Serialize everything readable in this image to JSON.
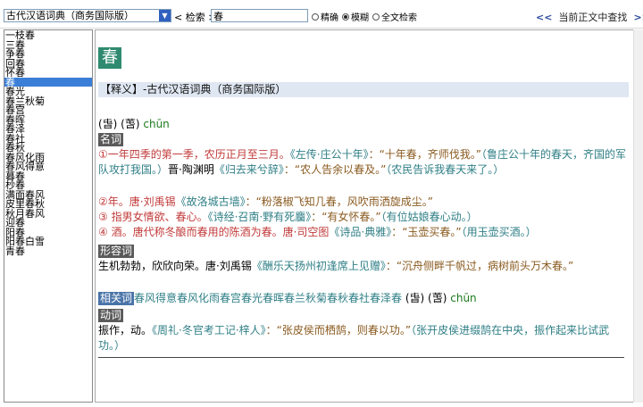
{
  "toolbar": {
    "dictionary": "古代汉语词典（商务国际版）",
    "search_label": "< 检索 >",
    "search_value": "春",
    "radio_exact": "精确",
    "radio_fuzzy": "模糊",
    "radio_fulltext": "全文检索",
    "find_in_text": "当前正文中查找",
    "prev": "<<",
    "next": ">>"
  },
  "list": {
    "items": [
      "一枝春",
      "三春",
      "争春",
      "回春",
      "怀春",
      "春",
      "春光",
      "春兰秋菊",
      "春宫",
      "春晖",
      "春泽",
      "春社",
      "春秋",
      "春风化雨",
      "春风得意",
      "暮春",
      "杪春",
      "满面春风",
      "皮里春秋",
      "秋月春风",
      "迎春",
      "阳春",
      "阳春白雪",
      "青春"
    ],
    "selected": "春"
  },
  "entry": {
    "headword": "春",
    "source_header": "【释义】-古代汉语词典（商务国际版）",
    "pinyin_prefix": "(旾) (萅)",
    "pinyin": "chūn",
    "noun_tag": "名词",
    "noun_1a": "①一年四季的第一季，农历正月至三月。",
    "noun_1b": "《左传·庄公十年》",
    "noun_1c": "：“十年春，齐师伐我。”",
    "noun_1d": "（鲁庄公十年的春天，齐国的军队攻打我国。）",
    "noun_1e": "晋·陶渊明",
    "noun_1f": "《归去来兮辞》",
    "noun_1g": "：“农人告余以春及。”",
    "noun_1h": "（农民告诉我春天来了。）",
    "noun_2a": "②年。唐·刘禹锡",
    "noun_2b": "《故洛城古墙》",
    "noun_2c": "：“粉落椒飞知几春，风吹雨洒旋成尘。”",
    "noun_3a": "③ 指男女情欲、春心。",
    "noun_3b": "《诗经·召南·野有死麕》",
    "noun_3c": "：“有女怀春。”",
    "noun_3d": "（有位姑娘春心动。）",
    "noun_4a": "④ 酒。唐代称冬酿而春用的陈酒为春。唐·司空图",
    "noun_4b": "《诗品·典雅》",
    "noun_4c": "：“玉壶买春。”",
    "noun_4d": "（用玉壶买酒。）",
    "adj_tag": "形容词",
    "adj_a": "生机勃勃，欣欣向荣。唐·刘禹锡",
    "adj_b": "《酬乐天扬州初逢席上见赠》",
    "adj_c": "：“沉舟侧畔千帆过，病树前头万木春。”",
    "related_tag": "相关词",
    "related_words": "春风得意春风化雨春宫春光春晖春兰秋菊春秋春社春泽春",
    "related_tail_prefix": "(旾) (萅)",
    "related_tail_pinyin": "chūn",
    "verb_tag": "动词",
    "verb_a": "振作，动。",
    "verb_b": "《周礼·冬官考工记·梓人》",
    "verb_c": "：“张皮侯而栖鹄，则春以功。”",
    "verb_d": "（张开皮侯进缀鹄在中央，振作起来比试武功。）"
  },
  "colors": {
    "accent": "#2f8a6f",
    "selection": "#3a7ed8",
    "quote": "#8a5a1f",
    "note": "#2f7f86",
    "pinyin": "#1b7a1b"
  }
}
